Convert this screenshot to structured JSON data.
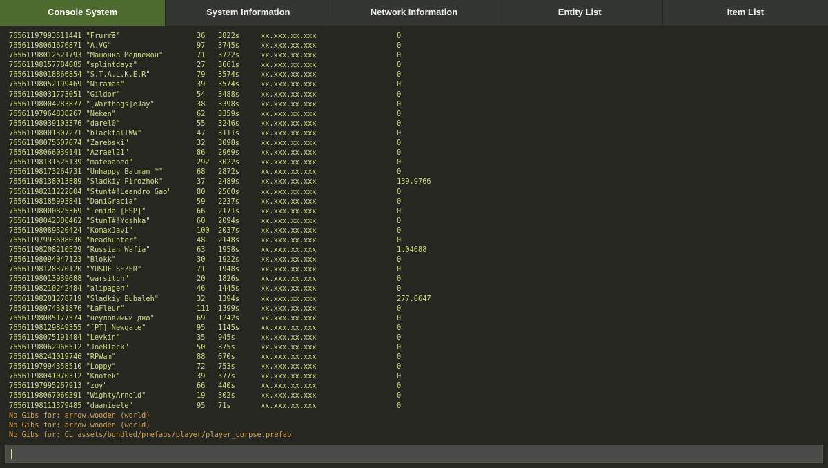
{
  "tabs": [
    {
      "label": "Console System",
      "active": true
    },
    {
      "label": "System Information",
      "active": false
    },
    {
      "label": "Network Information",
      "active": false
    },
    {
      "label": "Entity List",
      "active": false
    },
    {
      "label": "Item List",
      "active": false
    }
  ],
  "colors": {
    "active_tab": "#4e6a2e",
    "console_text": "#c7dc85",
    "warning_text": "#d3a155",
    "background": "#272721"
  },
  "console": {
    "rows": [
      {
        "line": "76561197993511441 \"Frurre\"",
        "num": "36",
        "time": "3822s",
        "ip": "xx.xxx.xx.xxx",
        "val": "0"
      },
      {
        "line": "76561198061676871 \"A.VG\"",
        "num": "97",
        "time": "3745s",
        "ip": "xx.xxx.xx.xxx",
        "val": "0"
      },
      {
        "line": "76561198012521793 \"Машонка Медвежон\"",
        "num": "71",
        "time": "3722s",
        "ip": "xx.xxx.xx.xxx",
        "val": "0"
      },
      {
        "line": "76561198157784085 \"splintdayz\"",
        "num": "27",
        "time": "3661s",
        "ip": "xx.xxx.xx.xxx",
        "val": "0"
      },
      {
        "line": "76561198018866854 \"S.T.A.L.K.E.R\"",
        "num": "79",
        "time": "3574s",
        "ip": "xx.xxx.xx.xxx",
        "val": "0"
      },
      {
        "line": "76561198052199469 \"Niramas\"",
        "num": "39",
        "time": "3574s",
        "ip": "xx.xxx.xx.xxx",
        "val": "0"
      },
      {
        "line": "76561198031773051 \"Gildor\"",
        "num": "54",
        "time": "3488s",
        "ip": "xx.xxx.xx.xxx",
        "val": "0"
      },
      {
        "line": "76561198004283877 \"[Warthogs]eJay\"",
        "num": "38",
        "time": "3398s",
        "ip": "xx.xxx.xx.xxx",
        "val": "0"
      },
      {
        "line": "76561197964838267 \"Neken\"",
        "num": "62",
        "time": "3359s",
        "ip": "xx.xxx.xx.xxx",
        "val": "0"
      },
      {
        "line": "76561198039103376 \"darel0\"",
        "num": "55",
        "time": "3246s",
        "ip": "xx.xxx.xx.xxx",
        "val": "0"
      },
      {
        "line": "76561198001307271 \"blacktallWW\"",
        "num": "47",
        "time": "3111s",
        "ip": "xx.xxx.xx.xxx",
        "val": "0"
      },
      {
        "line": "76561198075607074 \"Zarebski\"",
        "num": "32",
        "time": "3098s",
        "ip": "xx.xxx.xx.xxx",
        "val": "0"
      },
      {
        "line": "76561198066039141 \"Azrael21\"",
        "num": "86",
        "time": "2969s",
        "ip": "xx.xxx.xx.xxx",
        "val": "0"
      },
      {
        "line": "76561198131525139 \"mateoabed\"",
        "num": "292",
        "time": "3022s",
        "ip": "xx.xxx.xx.xxx",
        "val": "0"
      },
      {
        "line": "76561198173264731 \"Unhappy Batman ™\"",
        "num": "68",
        "time": "2872s",
        "ip": "xx.xxx.xx.xxx",
        "val": "0"
      },
      {
        "line": "76561198138013889 \"Sladkiy Pirozhok\"",
        "num": "37",
        "time": "2489s",
        "ip": "xx.xxx.xx.xxx",
        "val": "139.9766"
      },
      {
        "line": "76561198211222804 \"Stunt#!Leandro Gao\"",
        "num": "80",
        "time": "2560s",
        "ip": "xx.xxx.xx.xxx",
        "val": "0"
      },
      {
        "line": "76561198185993841 \"DaniGracia\"",
        "num": "59",
        "time": "2237s",
        "ip": "xx.xxx.xx.xxx",
        "val": "0"
      },
      {
        "line": "76561198000825369 \"lenida [ESP]\"",
        "num": "66",
        "time": "2171s",
        "ip": "xx.xxx.xx.xxx",
        "val": "0"
      },
      {
        "line": "76561198042380462 \"StunT#!Yoshka\"",
        "num": "60",
        "time": "2094s",
        "ip": "xx.xxx.xx.xxx",
        "val": "0"
      },
      {
        "line": "76561198089320424 \"KomaxJavi\"",
        "num": "100",
        "time": "2037s",
        "ip": "xx.xxx.xx.xxx",
        "val": "0"
      },
      {
        "line": "76561197993608030 \"headhunter\"",
        "num": "48",
        "time": "2148s",
        "ip": "xx.xxx.xx.xxx",
        "val": "0"
      },
      {
        "line": "76561198208210529 \"Russian Wafia\"",
        "num": "63",
        "time": "1958s",
        "ip": "xx.xxx.xx.xxx",
        "val": "1.04688"
      },
      {
        "line": "76561198094047123 \"Blokk\"",
        "num": "30",
        "time": "1922s",
        "ip": "xx.xxx.xx.xxx",
        "val": "0"
      },
      {
        "line": "76561198128370120 \"YUSUF SEZER\"",
        "num": "71",
        "time": "1948s",
        "ip": "xx.xxx.xx.xxx",
        "val": "0"
      },
      {
        "line": "76561198013939688 \"warsitch\"",
        "num": "20",
        "time": "1826s",
        "ip": "xx.xxx.xx.xxx",
        "val": "0"
      },
      {
        "line": "76561198210242484 \"alipagen\"",
        "num": "46",
        "time": "1445s",
        "ip": "xx.xxx.xx.xxx",
        "val": "0"
      },
      {
        "line": "76561198201278719 \"Sladkiy Bubaleh\"",
        "num": "32",
        "time": "1394s",
        "ip": "xx.xxx.xx.xxx",
        "val": "277.0647"
      },
      {
        "line": "76561198074301876 \"ŁaFleur\"",
        "num": "111",
        "time": "1399s",
        "ip": "xx.xxx.xx.xxx",
        "val": "0"
      },
      {
        "line": "76561198085177574 \"неуловимый джо\"",
        "num": "69",
        "time": "1242s",
        "ip": "xx.xxx.xx.xxx",
        "val": "0"
      },
      {
        "line": "76561198129849355 \"[PT] Newgate\"",
        "num": "95",
        "time": "1145s",
        "ip": "xx.xxx.xx.xxx",
        "val": "0"
      },
      {
        "line": "76561198075191484 \"Levkin\"",
        "num": "35",
        "time": "945s",
        "ip": "xx.xxx.xx.xxx",
        "val": "0"
      },
      {
        "line": "76561198062966512 \"JoeBlack\"",
        "num": "50",
        "time": "875s",
        "ip": "xx.xxx.xx.xxx",
        "val": "0"
      },
      {
        "line": "76561198241019746 \"RPWam\"",
        "num": "88",
        "time": "670s",
        "ip": "xx.xxx.xx.xxx",
        "val": "0"
      },
      {
        "line": "76561197994358510 \"Loppy\"",
        "num": "72",
        "time": "753s",
        "ip": "xx.xxx.xx.xxx",
        "val": "0"
      },
      {
        "line": "76561198041070312 \"Knotek\"",
        "num": "39",
        "time": "577s",
        "ip": "xx.xxx.xx.xxx",
        "val": "0"
      },
      {
        "line": "76561197995267913 \"zoy\"",
        "num": "66",
        "time": "440s",
        "ip": "xx.xxx.xx.xxx",
        "val": "0"
      },
      {
        "line": "76561198067060391 \"WightyArnold\"",
        "num": "19",
        "time": "302s",
        "ip": "xx.xxx.xx.xxx",
        "val": "0"
      },
      {
        "line": "76561198111379485 \"daanieele\"",
        "num": "95",
        "time": "71s",
        "ip": "xx.xxx.xx.xxx",
        "val": "0"
      }
    ],
    "messages": [
      "No Gibs for: arrow.wooden (world)",
      "No Gibs for: arrow.wooden (world)",
      "No Gibs for: CL assets/bundled/prefabs/player/player_corpse.prefab"
    ]
  },
  "input": {
    "value": ""
  }
}
